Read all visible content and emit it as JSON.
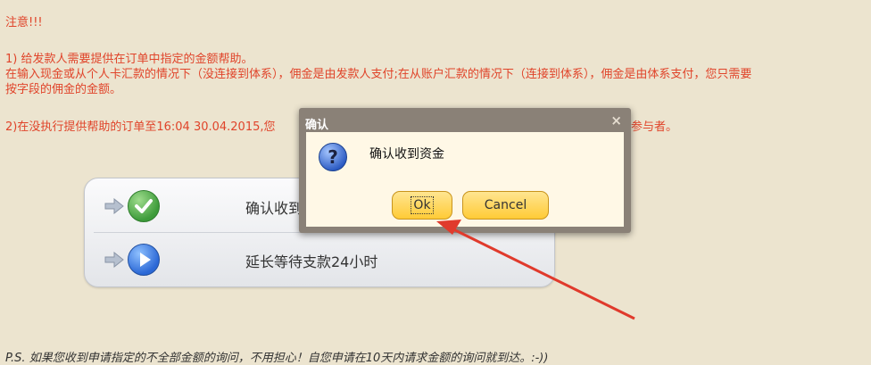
{
  "notice": {
    "title": "注意!!!",
    "p1": "1) 给发款人需要提供在订单中指定的金额帮助。",
    "p2": "在输入现金或从个人卡汇款的情况下（没连接到体系），佣金是由发款人支付;在从账户汇款的情况下（连接到体系），佣金是由体系支付，您只需要",
    "p3": "按字段的佣金的金额。",
    "p4": "2)在没执行提供帮助的订单至16:04 30.04.2015,您"
  },
  "notice_tail": "参与者。",
  "panel": {
    "items": [
      {
        "label": "确认收到",
        "icon": "check-icon"
      },
      {
        "label": "延长等待支款24小时",
        "icon": "play-icon"
      }
    ]
  },
  "dialog": {
    "title": "确认",
    "close_glyph": "×",
    "message": "确认收到资金",
    "ok_label": "Ok",
    "cancel_label": "Cancel",
    "question_glyph": "?"
  },
  "footer": {
    "ps": "P.S. 如果您收到申请指定的不全部金额的询问，不用担心！自您申请在10天内请求金额的询问就到达。:-))"
  },
  "colors": {
    "background": "#ece4cf",
    "notice_text": "#e0442a",
    "dialog_frame": "#8a8177",
    "button_fill": "#ffcb36",
    "pointer_arrow": "#e03a2c"
  }
}
